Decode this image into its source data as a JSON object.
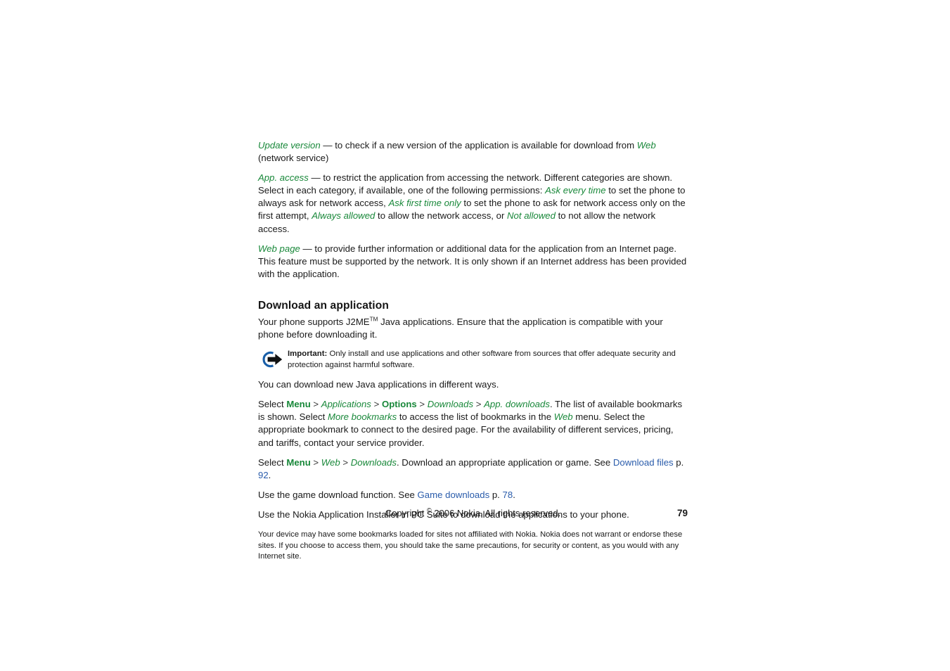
{
  "document": {
    "page_number": "79",
    "copyright": "Copyright ",
    "copyright_symbol": "©",
    "copyright_rest": " 2006 Nokia. All rights reserved."
  },
  "colors": {
    "green_term": "#19883a",
    "blue_link": "#2a5cab",
    "body_text": "#1a1a1a",
    "icon_blue": "#1a5fa8",
    "icon_black": "#111111"
  },
  "content": {
    "update_version": {
      "term": "Update version",
      "dash": " — ",
      "text_before_web": "to check if a new version of the application is available for download from ",
      "web_link": "Web",
      "text_after_web": " (network service)"
    },
    "app_access": {
      "term": "App. access",
      "dash": " — ",
      "p1": "to restrict the application from accessing the network. Different categories are shown. Select in each category, if available, one of the following permissions: ",
      "opt1": "Ask every time",
      "p2": " to set the phone to always ask for network access, ",
      "opt2": "Ask first time only",
      "p3": " to set the phone to ask for network access only on the first attempt, ",
      "opt3": "Always allowed",
      "p4": " to allow the network access, or ",
      "opt4": "Not allowed",
      "p5": " to not allow the network access."
    },
    "web_page": {
      "term": "Web page",
      "dash": " — ",
      "text": "to provide further information or additional data for the application from an Internet page. This feature must be supported by the network. It is only shown if an Internet address has been provided with the application."
    },
    "section_heading": "Download an application",
    "intro_before_tm": "Your phone supports J2ME",
    "intro_tm": "TM",
    "intro_after_tm": " Java applications. Ensure that the application is compatible with your phone before downloading it.",
    "important_note": {
      "icon": "important-arrow-icon",
      "label": "Important:",
      "text": " Only install and use applications and other software from sources that offer adequate security and protection against harmful software."
    },
    "ways_line": "You can download new Java applications in different ways.",
    "path1": {
      "select": "Select ",
      "menu": "Menu",
      "sep1": " > ",
      "applications": "Applications",
      "sep2": " > ",
      "options": "Options",
      "sep3": " > ",
      "downloads": "Downloads",
      "sep4": " > ",
      "app_downloads": "App. downloads",
      "after": ". The list of available bookmarks is shown. Select ",
      "more_bookmarks": "More bookmarks",
      "after2": " to access the list of bookmarks in the ",
      "web": "Web",
      "after3": " menu. Select the appropriate bookmark to connect to the desired page. For the availability of different services, pricing, and tariffs, contact your service provider."
    },
    "path2": {
      "select": "Select ",
      "menu": "Menu",
      "sep1": " > ",
      "web": "Web",
      "sep2": " > ",
      "downloads": "Downloads",
      "after": ". Download an appropriate application or game. See ",
      "link_text": "Download files",
      "link_mid": " p. ",
      "link_page": "92",
      "link_end": "."
    },
    "path3": {
      "before": "Use the game download function. See ",
      "link_text": "Game downloads",
      "link_mid": " p. ",
      "link_page": "78",
      "link_end": "."
    },
    "path4": "Use the Nokia Application Installer in PC Suite to download the applications to your phone.",
    "disclaimer": "Your device may have some bookmarks loaded for sites not affiliated with Nokia. Nokia does not warrant or endorse these sites. If you choose to access them, you should take the same precautions, for security or content, as you would with any Internet site."
  }
}
